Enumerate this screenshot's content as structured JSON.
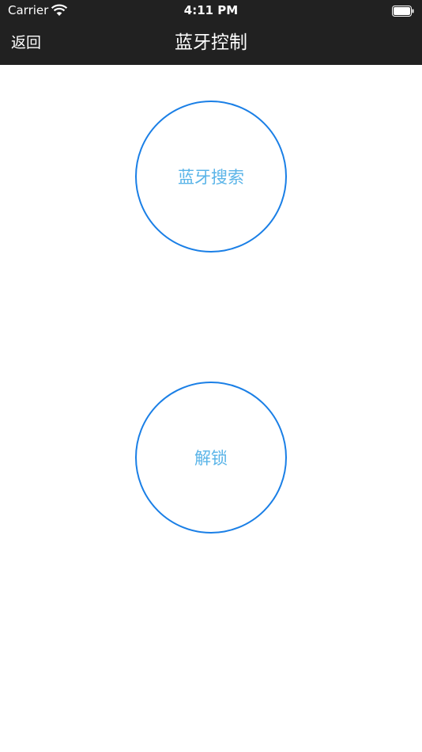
{
  "status_bar": {
    "carrier": "Carrier",
    "time": "4:11 PM",
    "icons": [
      "wifi-icon",
      "battery-icon"
    ]
  },
  "nav_bar": {
    "back_label": "返回",
    "title": "蓝牙控制",
    "background_color": "#212121"
  },
  "buttons": {
    "search_label": "蓝牙搜索",
    "unlock_label": "解锁",
    "border_color": "#1a7fe6",
    "text_color": "#5ab4e8"
  }
}
